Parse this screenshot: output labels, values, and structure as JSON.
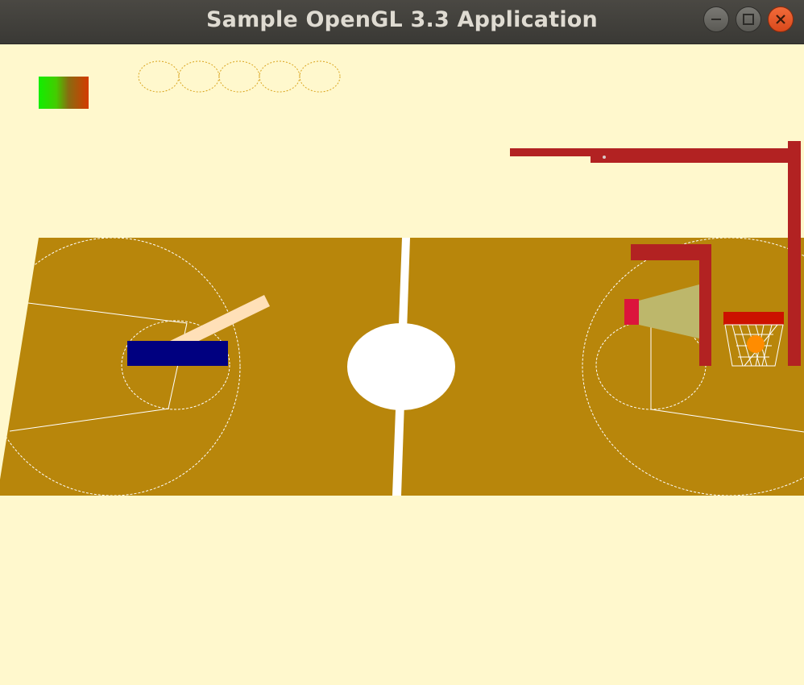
{
  "window": {
    "title": "Sample OpenGL 3.3 Application",
    "buttons": [
      "minimize",
      "maximize",
      "close"
    ]
  },
  "hud": {
    "power_meter_colors": [
      "#11ee00",
      "#d43a00"
    ],
    "lives_total": 5
  },
  "colors": {
    "background": "#fff8cd",
    "court": "#b8860b",
    "court_lines": "#ffffff",
    "hoop_frame": "#b22222",
    "player_body": "#000080",
    "player_arm": "#ffe0b8",
    "rim": "#cc1100",
    "ball": "#ff8c00",
    "cannon_tip": "#dc143c",
    "cannon_barrel": "#bdb76b",
    "hud_circles": "#daa520",
    "title_bar": "#3e3d39",
    "title_text": "#dfdbd2",
    "close_button": "#e95420"
  },
  "icons": {
    "minimize": "minus-icon",
    "maximize": "square-icon",
    "close": "x-icon"
  }
}
